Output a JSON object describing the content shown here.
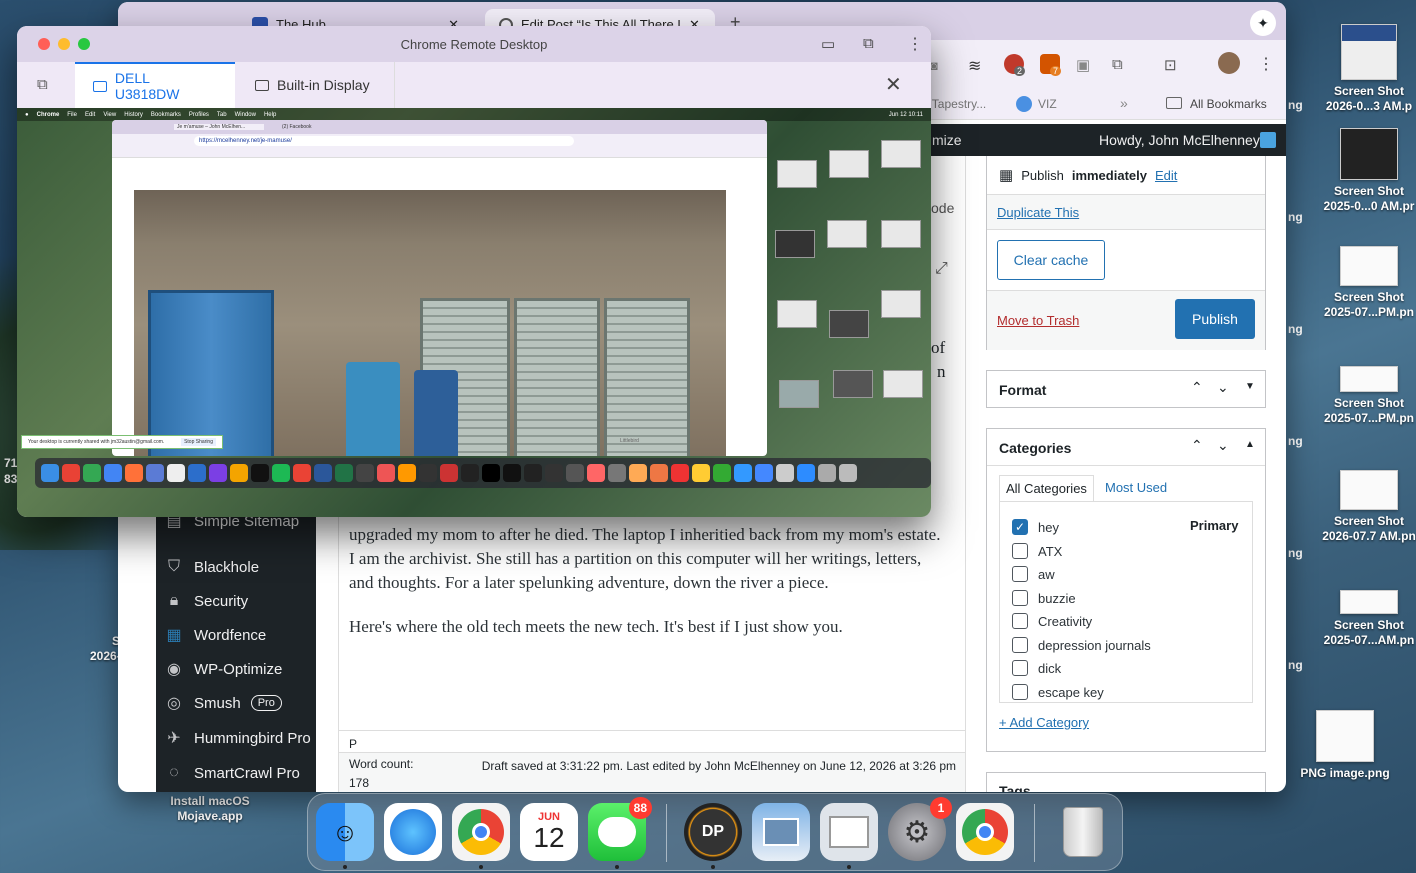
{
  "browser": {
    "tabs": [
      {
        "label": "The Hub"
      },
      {
        "label": "Edit Post “Is This All There Is?”"
      }
    ],
    "bookmarks": {
      "tapestry": "e Tapestry...",
      "viz": "VIZ",
      "all": "All Bookmarks"
    },
    "ext_badges": {
      "b1": "2",
      "b2": "7"
    }
  },
  "wp": {
    "adminbar": {
      "customize": "mize",
      "howdy": "Howdy, John McElhenney"
    },
    "sidebar": {
      "items": [
        {
          "label": "Simple Sitemap"
        },
        {
          "label": "Blackhole"
        },
        {
          "label": "Security"
        },
        {
          "label": "Wordfence"
        },
        {
          "label": "WP-Optimize"
        },
        {
          "label": "Smush"
        },
        {
          "label": "Hummingbird Pro"
        },
        {
          "label": "SmartCrawl Pro"
        }
      ],
      "smush_badge": "Pro"
    },
    "editor": {
      "frag_ode": "ode",
      "frag_of": "of",
      "frag_n": "n",
      "para1": "upgraded my mom to after he died. The laptop I inheritied back from my mom's estate. I am the archivist. She still has a partition on this computer will her writings, letters, and thoughts. For a later spelunking adventure, down the river a piece.",
      "para2": "Here's where the old tech meets the new tech. It's best if I just show you.",
      "block": "P",
      "wordcount_label": "Word count:",
      "wordcount": "178",
      "status": "Draft saved at 3:31:22 pm. Last edited by John McElhenney on June 12, 2026 at 3:26 pm"
    },
    "publish": {
      "schedule_prefix": "Publish",
      "schedule_value": "immediately",
      "edit": "Edit",
      "duplicate": "Duplicate This",
      "clear_cache": "Clear cache",
      "trash": "Move to Trash",
      "publish": "Publish"
    },
    "format": {
      "title": "Format"
    },
    "categories": {
      "title": "Categories",
      "tab_all": "All Categories",
      "tab_used": "Most Used",
      "primary": "Primary",
      "items": [
        {
          "label": "hey",
          "checked": true
        },
        {
          "label": "ATX",
          "checked": false
        },
        {
          "label": "aw",
          "checked": false
        },
        {
          "label": "buzzie",
          "checked": false
        },
        {
          "label": "Creativity",
          "checked": false
        },
        {
          "label": "depression journals",
          "checked": false
        },
        {
          "label": "dick",
          "checked": false
        },
        {
          "label": "escape key",
          "checked": false
        }
      ],
      "add": "+ Add Category"
    },
    "tags": {
      "title": "Tags"
    }
  },
  "remote": {
    "title": "Chrome Remote Desktop",
    "tab1": "DELL U3818DW",
    "tab2": "Built-in Display",
    "mini_menu": [
      "Chrome",
      "File",
      "Edit",
      "View",
      "History",
      "Bookmarks",
      "Profiles",
      "Tab",
      "Window",
      "Help"
    ],
    "mini_url": "https://mcelhenney.net/je-mamuse/",
    "mini_tab1": "Je m'amuse – John McElhen...",
    "mini_tab2": "(2) Facebook",
    "share_text": "Your desktop is currently shared with jm32austin@gmail.com.",
    "stop": "Stop Sharing",
    "clock": "Jun 12 10:11",
    "photo_credit": "Littlebird"
  },
  "desktop": {
    "left_edge_nums": [
      "71",
      "83"
    ],
    "files": [
      {
        "name": "Screen Shot",
        "sub": "2026-0...3 AM.p"
      },
      {
        "name": "Screen Shot",
        "sub": "2025-0...0 AM.pr"
      },
      {
        "name": "Screen Shot",
        "sub": "2025-07...PM.pn"
      },
      {
        "name": "Screen Shot",
        "sub": "2025-07...PM.pn"
      },
      {
        "name": "Screen Shot",
        "sub": "2026-07.7 AM.pn"
      },
      {
        "name": "Screen Shot",
        "sub": "2025-07...AM.pn"
      },
      {
        "name": "PNG image.png",
        "sub": ""
      }
    ],
    "left_file": {
      "name": "Screen",
      "sub": "2026-0...9"
    },
    "mojave": {
      "line1": "Install macOS",
      "line2": "Mojave.app"
    },
    "edge_ng": "ng"
  },
  "dock": {
    "calendar_month": "JUN",
    "calendar_day": "12",
    "messages_badge": "88",
    "settings_badge": "1",
    "dp_label": "DP"
  }
}
